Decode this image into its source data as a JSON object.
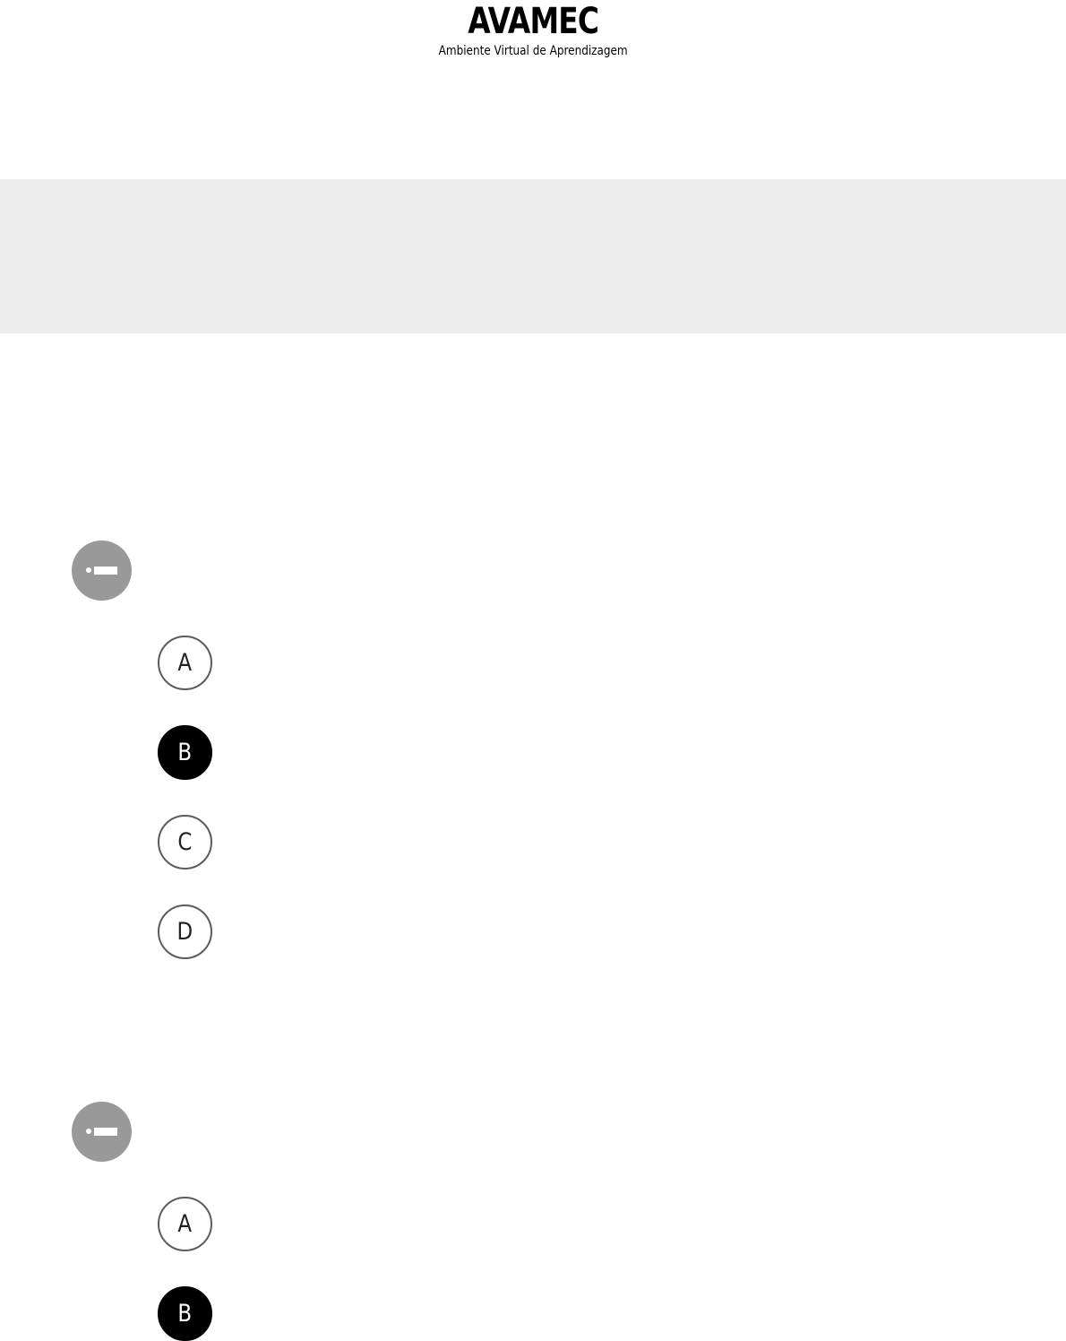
{
  "header": {
    "logo_title": "AVAMEC",
    "logo_subtitle": "Ambiente Virtual de Aprendizagem"
  },
  "questions": [
    {
      "badge_icon": "question-marker-icon",
      "options": [
        {
          "letter": "A",
          "selected": false
        },
        {
          "letter": "B",
          "selected": true
        },
        {
          "letter": "C",
          "selected": false
        },
        {
          "letter": "D",
          "selected": false
        }
      ]
    },
    {
      "badge_icon": "question-marker-icon",
      "options": [
        {
          "letter": "A",
          "selected": false
        },
        {
          "letter": "B",
          "selected": true
        }
      ]
    }
  ],
  "colors": {
    "banner": "#ededed",
    "badge": "#999999",
    "selected_option": "#000000",
    "option_border": "#5c5c5c"
  }
}
